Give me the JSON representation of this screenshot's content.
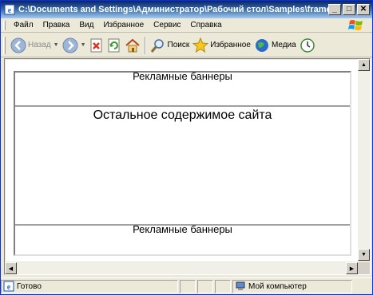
{
  "window": {
    "title": "C:\\Documents and Settings\\Администратор\\Рабочий стол\\Samples\\frame.ht...",
    "minimize": "_",
    "maximize": "□",
    "close": "✕"
  },
  "menu": {
    "items": [
      {
        "label": "Файл"
      },
      {
        "label": "Правка"
      },
      {
        "label": "Вид"
      },
      {
        "label": "Избранное"
      },
      {
        "label": "Сервис"
      },
      {
        "label": "Справка"
      }
    ]
  },
  "toolbar": {
    "back_label": "Назад",
    "search_label": "Поиск",
    "favorites_label": "Избранное",
    "media_label": "Медиа"
  },
  "page": {
    "top_banner": "Рекламные баннеры",
    "main_content": "Остальное содержимое сайта",
    "bottom_banner": "Рекламные баннеры"
  },
  "status": {
    "text": "Готово",
    "zone": "Мой компьютер"
  },
  "colors": {
    "titlebar_start": "#0a246a",
    "titlebar_end": "#a6caf0",
    "chrome": "#ece9d8"
  }
}
